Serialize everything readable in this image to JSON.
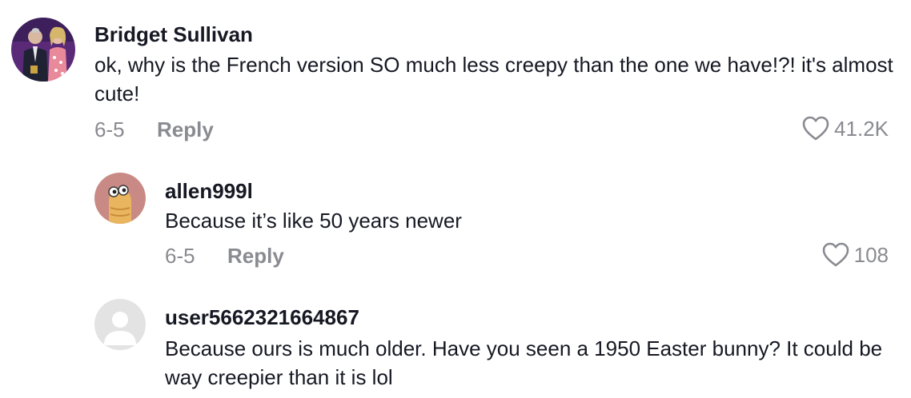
{
  "comments": [
    {
      "username": "Bridget Sullivan",
      "text": "ok, why is the French version SO much less creepy than the one we have!?! it's almost cute!",
      "date": "6-5",
      "reply_label": "Reply",
      "likes": "41.2K",
      "avatar_icon": "user-photo-avatar"
    },
    {
      "username": "allen999l",
      "text": "Because it’s like 50 years newer",
      "date": "6-5",
      "reply_label": "Reply",
      "likes": "108",
      "avatar_icon": "cartoon-avatar"
    },
    {
      "username": "user5662321664867",
      "text": "Because ours is much older. Have you seen a 1950 Easter bunny? It could be way creepier than it is lol",
      "avatar_icon": "default-user-avatar"
    }
  ],
  "colors": {
    "text_primary": "#161823",
    "text_secondary": "#8a8b91",
    "avatar_default_bg": "#e3e3e4",
    "avatar_cartoon_bg": "#c98a85"
  }
}
